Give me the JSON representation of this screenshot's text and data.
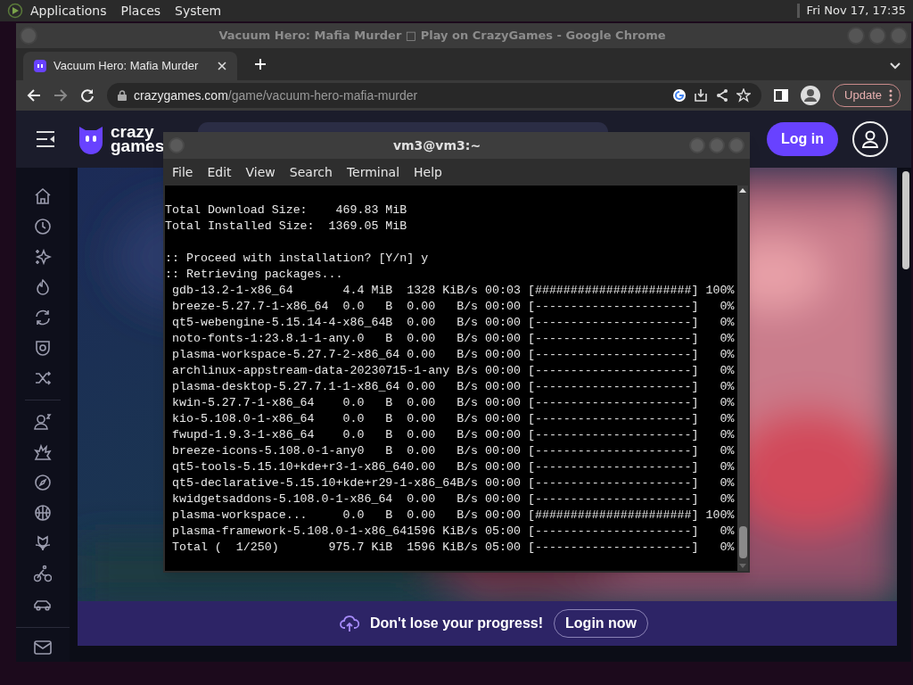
{
  "top_panel": {
    "menus": [
      "Applications",
      "Places",
      "System"
    ],
    "clock": "Fri Nov 17, 17:35"
  },
  "browser": {
    "title": "Vacuum Hero: Mafia Murder □ Play on CrazyGames - Google Chrome",
    "tabs": [
      {
        "title": "Vacuum Hero: Mafia Murder",
        "selected": true
      }
    ],
    "url_host": "crazygames.com",
    "url_path": "/game/vacuum-hero-mafia-murder",
    "update_label": "Update"
  },
  "site": {
    "logo": [
      "crazy",
      "games"
    ],
    "login": "Log in",
    "banner": {
      "text": "Don't lose your progress!",
      "button": "Login now"
    }
  },
  "terminal": {
    "title": "vm3@vm3:~",
    "menus": [
      "File",
      "Edit",
      "View",
      "Search",
      "Terminal",
      "Help"
    ],
    "blocks": [
      [
        "Total Download Size:    469.83 MiB",
        "Total Installed Size:  1369.05 MiB"
      ],
      [
        ":: Proceed with installation? [Y/n] y",
        ":: Retrieving packages...",
        " gdb-13.2-1-x86_64       4.4 MiB  1328 KiB/s 00:03 [######################] 100%",
        " breeze-5.27.7-1-x86_64  0.0   B  0.00   B/s 00:00 [----------------------]   0%",
        " qt5-webengine-5.15.14-4-x86_64B  0.00   B/s 00:00 [----------------------]   0%",
        " noto-fonts-1:23.8.1-1-any.0   B  0.00   B/s 00:00 [----------------------]   0%",
        " plasma-workspace-5.27.7-2-x86_64 0.00   B/s 00:00 [----------------------]   0%",
        " archlinux-appstream-data-20230715-1-any B/s 00:00 [----------------------]   0%",
        " plasma-desktop-5.27.7.1-1-x86_64 0.00   B/s 00:00 [----------------------]   0%",
        " kwin-5.27.7-1-x86_64    0.0   B  0.00   B/s 00:00 [----------------------]   0%",
        " kio-5.108.0-1-x86_64    0.0   B  0.00   B/s 00:00 [----------------------]   0%",
        " fwupd-1.9.3-1-x86_64    0.0   B  0.00   B/s 00:00 [----------------------]   0%",
        " breeze-icons-5.108.0-1-any0   B  0.00   B/s 00:00 [----------------------]   0%",
        " qt5-tools-5.15.10+kde+r3-1-x86_640.00   B/s 00:00 [----------------------]   0%",
        " qt5-declarative-5.15.10+kde+r29-1-x86_64B/s 00:00 [----------------------]   0%",
        " kwidgetsaddons-5.108.0-1-x86_64  0.00   B/s 00:00 [----------------------]   0%",
        " plasma-workspace...     0.0   B  0.00   B/s 00:00 [######################] 100%",
        " plasma-framework-5.108.0-1-x86_641596 KiB/s 05:00 [----------------------]   0%",
        " Total (  1/250)       975.7 KiB  1596 KiB/s 05:00 [----------------------]   0%"
      ]
    ]
  }
}
